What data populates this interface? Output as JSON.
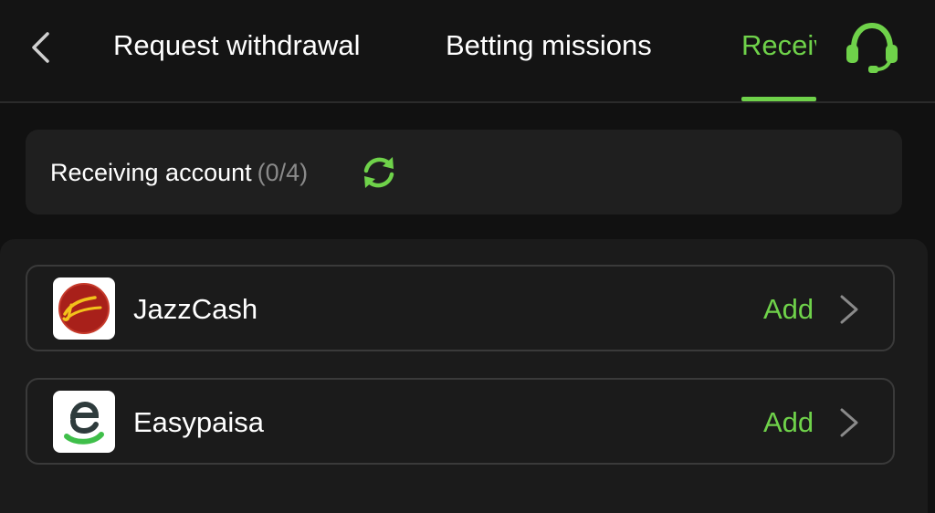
{
  "header": {
    "back_icon": "chevron-left-icon",
    "tabs": [
      {
        "label": "Request withdrawal",
        "active": false
      },
      {
        "label": "Betting missions",
        "active": false
      },
      {
        "label": "Receiving account",
        "active": true
      }
    ],
    "support_icon": "headset-icon"
  },
  "account": {
    "label": "Receiving account",
    "count": "(0/4)",
    "refresh_icon": "refresh-icon"
  },
  "methods": [
    {
      "name": "JazzCash",
      "action": "Add",
      "logo_icon": "jazzcash-logo-icon"
    },
    {
      "name": "Easypaisa",
      "action": "Add",
      "logo_icon": "easypaisa-logo-icon"
    }
  ],
  "colors": {
    "accent": "#6fd24a",
    "background": "#111111",
    "card": "#1f1f1f",
    "border": "#3a3a3a",
    "muted_text": "#8a8a8a",
    "jazz_red": "#a8201a",
    "jazz_yellow": "#f2c21b",
    "easypaisa_green": "#3fbf4a",
    "easypaisa_dark": "#2e3b3c"
  }
}
